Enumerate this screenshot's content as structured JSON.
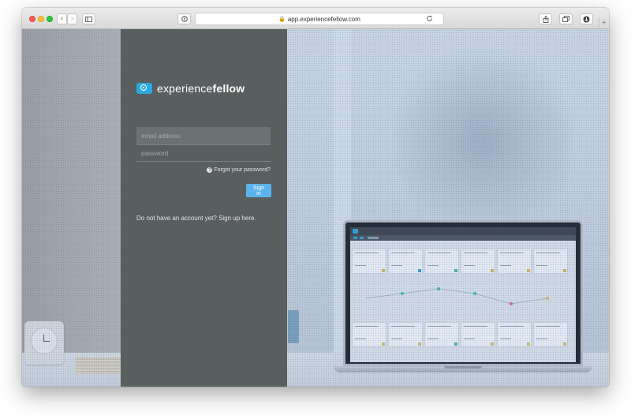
{
  "browser": {
    "url": "app.experiencefellow.com",
    "icons": [
      "back-icon",
      "forward-icon",
      "sidebar-icon",
      "privacy-icon",
      "lock-icon",
      "reload-icon",
      "share-icon",
      "tabs-icon",
      "download-icon",
      "new-tab-icon"
    ]
  },
  "brand": {
    "prefix": "experience",
    "suffix": "fellow"
  },
  "login": {
    "email_placeholder": "email address",
    "password_placeholder": "password",
    "forgot_label": "Forgot your password?",
    "signin_label": "Sign in",
    "signup_text": "Do not have an account yet? Sign up here."
  },
  "colors": {
    "panel": "#595e5f",
    "accent": "#5db3ec",
    "brand_blue": "#2aa8e0"
  }
}
